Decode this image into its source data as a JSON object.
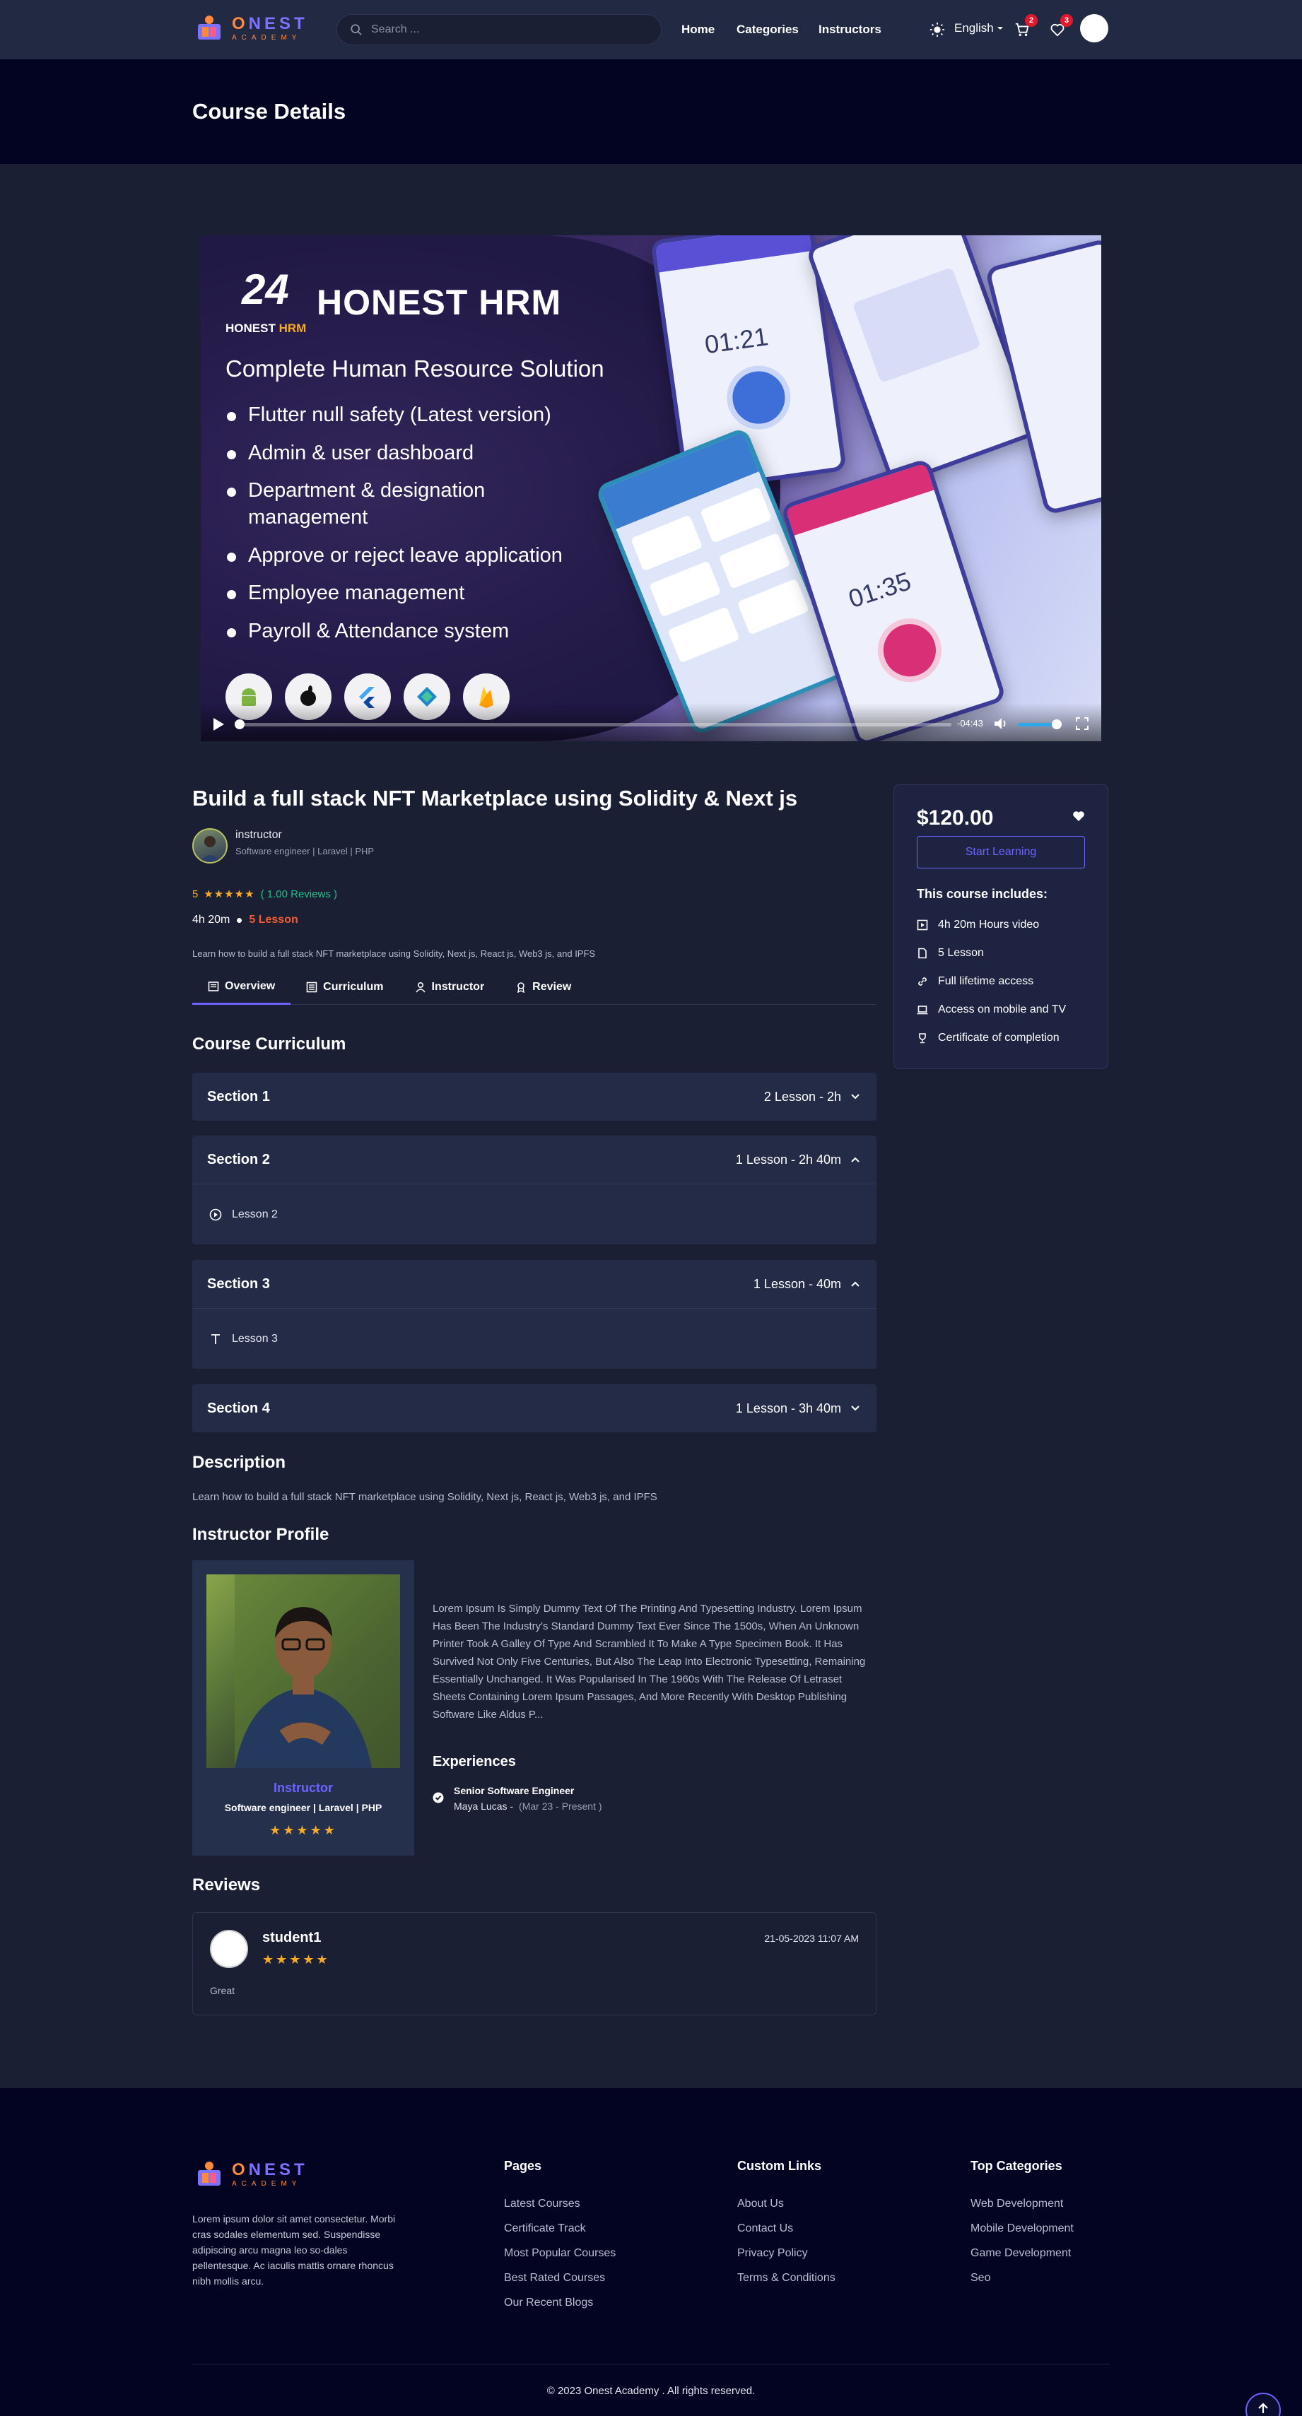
{
  "header": {
    "logo_main": "ONEST",
    "logo_sub": "ACADEMY",
    "search_placeholder": "Search ...",
    "nav": [
      "Home",
      "Categories",
      "Instructors"
    ],
    "language": "English",
    "cart_count": "2",
    "wishlist_count": "3"
  },
  "page_title": "Course Details",
  "banner": {
    "brand_num": "24",
    "brand_name": "HONEST HRM",
    "brand_small_a": "HONEST",
    "brand_small_b": "HRM",
    "subtitle": "Complete Human Resource Solution",
    "features": [
      "Flutter null safety (Latest version)",
      "Admin & user dashboard",
      "Department & designation management",
      "Approve or reject leave application",
      "Employee management",
      "Payroll & Attendance system"
    ],
    "video_time": "-04:43",
    "phone_times": [
      "01:21",
      "01:35"
    ]
  },
  "course": {
    "title": "Build a full stack NFT Marketplace using Solidity & Next js",
    "instructor_name": "instructor",
    "instructor_role": "Software engineer | Laravel | PHP",
    "rating": "5",
    "reviews": "( 1.00 Reviews )",
    "duration": "4h 20m",
    "lessons": "5 Lesson",
    "short_description": "Learn how to build a full stack NFT marketplace using Solidity, Next js, React js, Web3 js, and IPFS"
  },
  "tabs": [
    "Overview",
    "Curriculum",
    "Instructor",
    "Review"
  ],
  "curriculum": {
    "heading": "Course Curriculum",
    "sections": [
      {
        "title": "Section 1",
        "meta": "2 Lesson - 2h",
        "expanded": false,
        "lesson": ""
      },
      {
        "title": "Section 2",
        "meta": "1 Lesson - 2h 40m",
        "expanded": true,
        "lesson": "Lesson 2"
      },
      {
        "title": "Section 3",
        "meta": "1 Lesson - 40m",
        "expanded": true,
        "lesson": "Lesson 3"
      },
      {
        "title": "Section 4",
        "meta": "1 Lesson - 3h 40m",
        "expanded": false,
        "lesson": ""
      }
    ]
  },
  "description": {
    "heading": "Description",
    "text": "Learn how to build a full stack NFT marketplace using Solidity, Next js, React js, Web3 js, and IPFS"
  },
  "instructor_profile": {
    "heading": "Instructor Profile",
    "name": "Instructor",
    "role": "Software engineer | Laravel | PHP",
    "stars": "★★★★★",
    "bio": "Lorem Ipsum Is Simply Dummy Text Of The Printing And Typesetting Industry. Lorem Ipsum Has Been The Industry's Standard Dummy Text Ever Since The 1500s, When An Unknown Printer Took A Galley Of Type And Scrambled It To Make A Type Specimen Book. It Has Survived Not Only Five Centuries, But Also The Leap Into Electronic Typesetting, Remaining Essentially Unchanged. It Was Popularised In The 1960s With The Release Of Letraset Sheets Containing Lorem Ipsum Passages, And More Recently With Desktop Publishing Software Like Aldus P...",
    "experiences_heading": "Experiences",
    "experience_role": "Senior Software Engineer",
    "experience_company": "Maya Lucas -",
    "experience_period": "(Mar 23 - Present )"
  },
  "reviews": {
    "heading": "Reviews",
    "items": [
      {
        "name": "student1",
        "stars": "★★★★★",
        "date": "21-05-2023 11:07 AM",
        "text": "Great"
      }
    ]
  },
  "sidebar": {
    "price": "$120.00",
    "button": "Start Learning",
    "includes_heading": "This course includes:",
    "includes": [
      "4h 20m Hours video",
      "5 Lesson",
      "Full lifetime access",
      "Access on mobile and TV",
      "Certificate of completion"
    ]
  },
  "footer": {
    "about": "Lorem ipsum dolor sit amet consectetur. Morbi cras sodales elementum sed. Suspendisse adipiscing arcu magna leo so-dales pellentesque. Ac iaculis mattis ornare rhoncus nibh mollis arcu.",
    "columns": [
      {
        "title": "Pages",
        "links": [
          "Latest Courses",
          "Certificate Track",
          "Most Popular Courses",
          "Best Rated Courses",
          "Our Recent Blogs"
        ]
      },
      {
        "title": "Custom Links",
        "links": [
          "About Us",
          "Contact Us",
          "Privacy Policy",
          "Terms & Conditions"
        ]
      },
      {
        "title": "Top Categories",
        "links": [
          "Web Development",
          "Mobile Development",
          "Game Development",
          "Seo"
        ]
      }
    ],
    "copyright": "© 2023 Onest Academy . All rights reserved."
  },
  "colors": {
    "accent": "#6c63ff",
    "star": "#f7a928",
    "success": "#19c48a",
    "lesson_highlight": "#f55b2d",
    "page_bg": "#1a1f33",
    "header_bg": "#222a43",
    "dark_bg": "#020422"
  }
}
